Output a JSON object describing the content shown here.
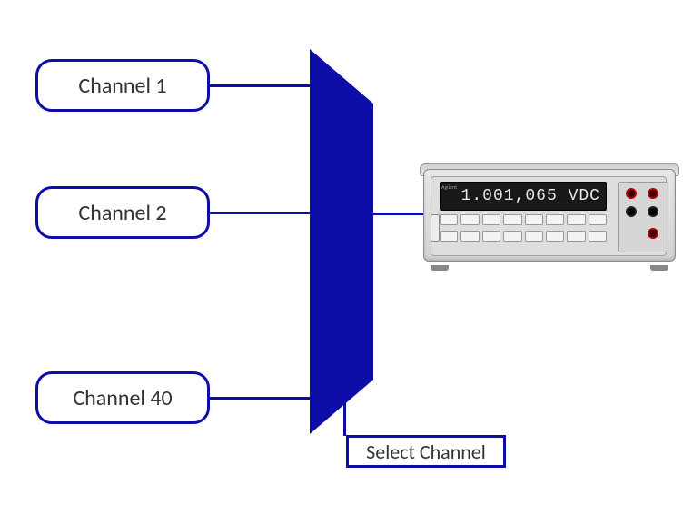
{
  "channels": [
    {
      "label": "Channel 1"
    },
    {
      "label": "Channel 2"
    },
    {
      "label": "Channel 40"
    }
  ],
  "select_label": "Select Channel",
  "instrument": {
    "brand": "Agilent",
    "display_text": "1.001,065  VDC"
  }
}
